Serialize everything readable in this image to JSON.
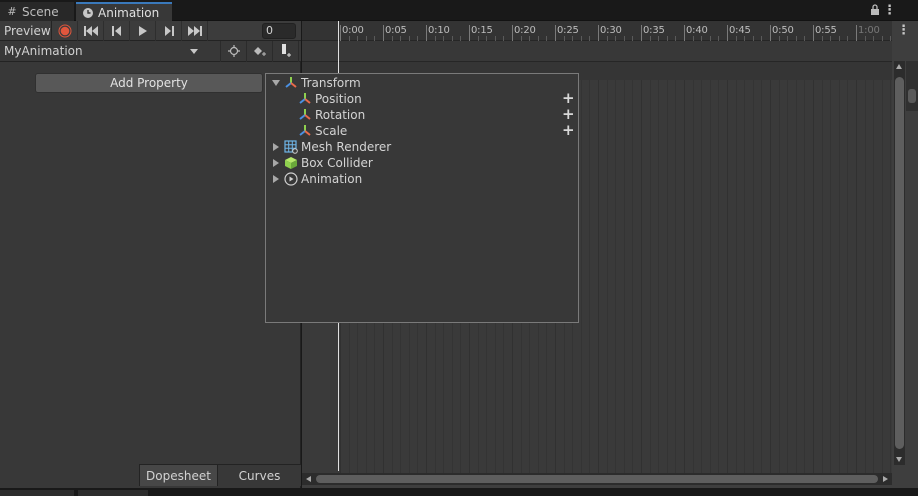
{
  "tabs": [
    {
      "label": "Scene",
      "icon": "grid-icon"
    },
    {
      "label": "Animation",
      "icon": "clock-icon"
    }
  ],
  "toolbar": {
    "preview_label": "Preview",
    "frame_value": "0",
    "clip_name": "MyAnimation",
    "record_color": "#e0563d"
  },
  "add_property_label": "Add Property",
  "bottom_tabs": {
    "dopesheet": "Dopesheet",
    "curves": "Curves"
  },
  "ruler": {
    "labels": [
      "0:00",
      "0:05",
      "0:10",
      "0:15",
      "0:20",
      "0:25",
      "0:30",
      "0:35",
      "0:40",
      "0:45",
      "0:50",
      "0:55",
      "1:00"
    ]
  },
  "property_popup": {
    "items": [
      {
        "label": "Transform",
        "expanded": true,
        "icon": "transform-icon",
        "children": [
          {
            "label": "Position",
            "icon": "transform-icon",
            "action": "+"
          },
          {
            "label": "Rotation",
            "icon": "transform-icon",
            "action": "+"
          },
          {
            "label": "Scale",
            "icon": "transform-icon",
            "action": "+"
          }
        ]
      },
      {
        "label": "Mesh Renderer",
        "expanded": false,
        "icon": "mesh-renderer-icon"
      },
      {
        "label": "Box Collider",
        "expanded": false,
        "icon": "box-collider-icon"
      },
      {
        "label": "Animation",
        "expanded": false,
        "icon": "animation-icon"
      }
    ]
  },
  "colors": {
    "accent": "#3a79bb",
    "panel": "#383838",
    "timeline": "#3a3a3a"
  }
}
